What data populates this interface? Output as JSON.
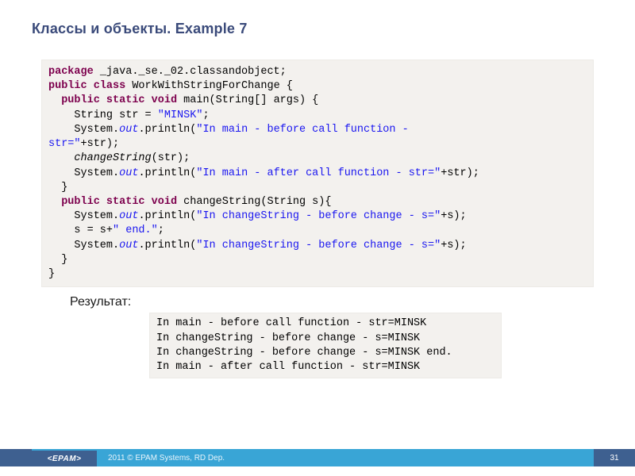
{
  "title": "Классы и объекты. Example 7",
  "code": {
    "package_kw": "package",
    "package_name": " _java._se._02.classandobject;",
    "public_kw": "public",
    "class_kw": "class",
    "static_kw": "static",
    "void_kw": "void",
    "class_name": " WorkWithStringForChange {",
    "main_sig": " main(String[] args) {",
    "str_decl_pre": "    String str = ",
    "str_decl_lit": "\"MINSK\"",
    "semicolon": ";",
    "sys": "    System.",
    "sys2": "System.",
    "out": "out",
    "println_open": ".println(",
    "lit1": "\"In main - before call function - ",
    "lit1b": "str=\"",
    "plus_str": "+str);",
    "change_call": "changeString",
    "change_arg": "(str);",
    "lit2": "\"In main - after call function - str=\"",
    "close_brace": "  }",
    "close_brace2": "}",
    "change_sig": " changeString(String s){",
    "lit3": "\"In changeString - before change - s=\"",
    "plus_s": "+s);",
    "sassign_pre": "    s = s+",
    "sassign_lit": "\" end.\"",
    "indent2": "  ",
    "indent4": "    "
  },
  "result_label": "Результат:",
  "result": {
    "l1": "In main - before call function - str=MINSK",
    "l2": "In changeString - before change - s=MINSK",
    "l3": "In changeString - before change - s=MINSK end.",
    "l4": "In main - after call function - str=MINSK"
  },
  "footer": {
    "logo": "EPAM",
    "copyright": "2011 © EPAM Systems, RD Dep.",
    "page": "31"
  }
}
